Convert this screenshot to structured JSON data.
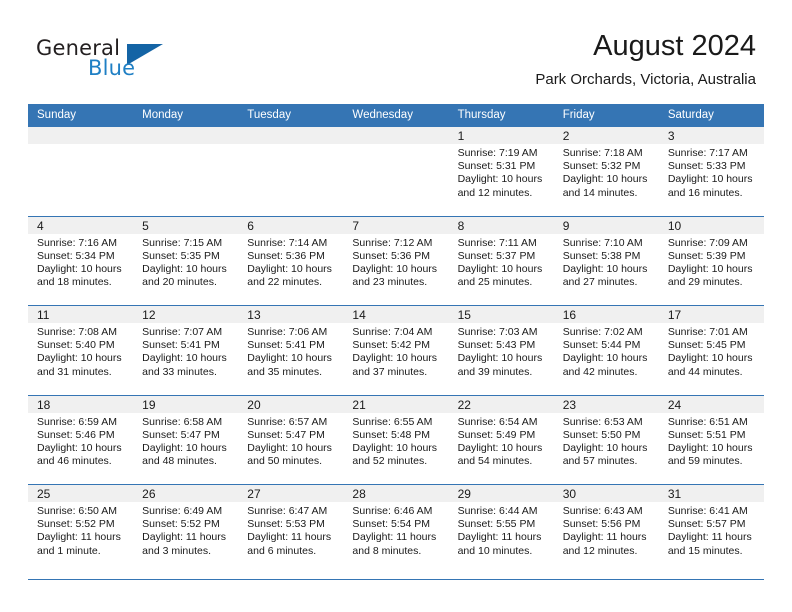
{
  "logo": {
    "text_primary": "General",
    "text_secondary": "Blue",
    "triangle_color": "#1464a5",
    "secondary_color": "#1f7fc4"
  },
  "header": {
    "title": "August 2024",
    "subtitle": "Park Orchards, Victoria, Australia"
  },
  "theme": {
    "header_blue": "#3575b4",
    "day_band_gray": "#f0f0f0",
    "text_color": "#1a1a1a"
  },
  "weekdays": [
    "Sunday",
    "Monday",
    "Tuesday",
    "Wednesday",
    "Thursday",
    "Friday",
    "Saturday"
  ],
  "weeks": [
    [
      {
        "day": "",
        "empty": true,
        "lines": []
      },
      {
        "day": "",
        "empty": true,
        "lines": []
      },
      {
        "day": "",
        "empty": true,
        "lines": []
      },
      {
        "day": "",
        "empty": true,
        "lines": []
      },
      {
        "day": "1",
        "empty": false,
        "lines": [
          "Sunrise: 7:19 AM",
          "Sunset: 5:31 PM",
          "Daylight: 10 hours",
          "and 12 minutes."
        ]
      },
      {
        "day": "2",
        "empty": false,
        "lines": [
          "Sunrise: 7:18 AM",
          "Sunset: 5:32 PM",
          "Daylight: 10 hours",
          "and 14 minutes."
        ]
      },
      {
        "day": "3",
        "empty": false,
        "lines": [
          "Sunrise: 7:17 AM",
          "Sunset: 5:33 PM",
          "Daylight: 10 hours",
          "and 16 minutes."
        ]
      }
    ],
    [
      {
        "day": "4",
        "empty": false,
        "lines": [
          "Sunrise: 7:16 AM",
          "Sunset: 5:34 PM",
          "Daylight: 10 hours",
          "and 18 minutes."
        ]
      },
      {
        "day": "5",
        "empty": false,
        "lines": [
          "Sunrise: 7:15 AM",
          "Sunset: 5:35 PM",
          "Daylight: 10 hours",
          "and 20 minutes."
        ]
      },
      {
        "day": "6",
        "empty": false,
        "lines": [
          "Sunrise: 7:14 AM",
          "Sunset: 5:36 PM",
          "Daylight: 10 hours",
          "and 22 minutes."
        ]
      },
      {
        "day": "7",
        "empty": false,
        "lines": [
          "Sunrise: 7:12 AM",
          "Sunset: 5:36 PM",
          "Daylight: 10 hours",
          "and 23 minutes."
        ]
      },
      {
        "day": "8",
        "empty": false,
        "lines": [
          "Sunrise: 7:11 AM",
          "Sunset: 5:37 PM",
          "Daylight: 10 hours",
          "and 25 minutes."
        ]
      },
      {
        "day": "9",
        "empty": false,
        "lines": [
          "Sunrise: 7:10 AM",
          "Sunset: 5:38 PM",
          "Daylight: 10 hours",
          "and 27 minutes."
        ]
      },
      {
        "day": "10",
        "empty": false,
        "lines": [
          "Sunrise: 7:09 AM",
          "Sunset: 5:39 PM",
          "Daylight: 10 hours",
          "and 29 minutes."
        ]
      }
    ],
    [
      {
        "day": "11",
        "empty": false,
        "lines": [
          "Sunrise: 7:08 AM",
          "Sunset: 5:40 PM",
          "Daylight: 10 hours",
          "and 31 minutes."
        ]
      },
      {
        "day": "12",
        "empty": false,
        "lines": [
          "Sunrise: 7:07 AM",
          "Sunset: 5:41 PM",
          "Daylight: 10 hours",
          "and 33 minutes."
        ]
      },
      {
        "day": "13",
        "empty": false,
        "lines": [
          "Sunrise: 7:06 AM",
          "Sunset: 5:41 PM",
          "Daylight: 10 hours",
          "and 35 minutes."
        ]
      },
      {
        "day": "14",
        "empty": false,
        "lines": [
          "Sunrise: 7:04 AM",
          "Sunset: 5:42 PM",
          "Daylight: 10 hours",
          "and 37 minutes."
        ]
      },
      {
        "day": "15",
        "empty": false,
        "lines": [
          "Sunrise: 7:03 AM",
          "Sunset: 5:43 PM",
          "Daylight: 10 hours",
          "and 39 minutes."
        ]
      },
      {
        "day": "16",
        "empty": false,
        "lines": [
          "Sunrise: 7:02 AM",
          "Sunset: 5:44 PM",
          "Daylight: 10 hours",
          "and 42 minutes."
        ]
      },
      {
        "day": "17",
        "empty": false,
        "lines": [
          "Sunrise: 7:01 AM",
          "Sunset: 5:45 PM",
          "Daylight: 10 hours",
          "and 44 minutes."
        ]
      }
    ],
    [
      {
        "day": "18",
        "empty": false,
        "lines": [
          "Sunrise: 6:59 AM",
          "Sunset: 5:46 PM",
          "Daylight: 10 hours",
          "and 46 minutes."
        ]
      },
      {
        "day": "19",
        "empty": false,
        "lines": [
          "Sunrise: 6:58 AM",
          "Sunset: 5:47 PM",
          "Daylight: 10 hours",
          "and 48 minutes."
        ]
      },
      {
        "day": "20",
        "empty": false,
        "lines": [
          "Sunrise: 6:57 AM",
          "Sunset: 5:47 PM",
          "Daylight: 10 hours",
          "and 50 minutes."
        ]
      },
      {
        "day": "21",
        "empty": false,
        "lines": [
          "Sunrise: 6:55 AM",
          "Sunset: 5:48 PM",
          "Daylight: 10 hours",
          "and 52 minutes."
        ]
      },
      {
        "day": "22",
        "empty": false,
        "lines": [
          "Sunrise: 6:54 AM",
          "Sunset: 5:49 PM",
          "Daylight: 10 hours",
          "and 54 minutes."
        ]
      },
      {
        "day": "23",
        "empty": false,
        "lines": [
          "Sunrise: 6:53 AM",
          "Sunset: 5:50 PM",
          "Daylight: 10 hours",
          "and 57 minutes."
        ]
      },
      {
        "day": "24",
        "empty": false,
        "lines": [
          "Sunrise: 6:51 AM",
          "Sunset: 5:51 PM",
          "Daylight: 10 hours",
          "and 59 minutes."
        ]
      }
    ],
    [
      {
        "day": "25",
        "empty": false,
        "lines": [
          "Sunrise: 6:50 AM",
          "Sunset: 5:52 PM",
          "Daylight: 11 hours",
          "and 1 minute."
        ]
      },
      {
        "day": "26",
        "empty": false,
        "lines": [
          "Sunrise: 6:49 AM",
          "Sunset: 5:52 PM",
          "Daylight: 11 hours",
          "and 3 minutes."
        ]
      },
      {
        "day": "27",
        "empty": false,
        "lines": [
          "Sunrise: 6:47 AM",
          "Sunset: 5:53 PM",
          "Daylight: 11 hours",
          "and 6 minutes."
        ]
      },
      {
        "day": "28",
        "empty": false,
        "lines": [
          "Sunrise: 6:46 AM",
          "Sunset: 5:54 PM",
          "Daylight: 11 hours",
          "and 8 minutes."
        ]
      },
      {
        "day": "29",
        "empty": false,
        "lines": [
          "Sunrise: 6:44 AM",
          "Sunset: 5:55 PM",
          "Daylight: 11 hours",
          "and 10 minutes."
        ]
      },
      {
        "day": "30",
        "empty": false,
        "lines": [
          "Sunrise: 6:43 AM",
          "Sunset: 5:56 PM",
          "Daylight: 11 hours",
          "and 12 minutes."
        ]
      },
      {
        "day": "31",
        "empty": false,
        "lines": [
          "Sunrise: 6:41 AM",
          "Sunset: 5:57 PM",
          "Daylight: 11 hours",
          "and 15 minutes."
        ]
      }
    ]
  ]
}
